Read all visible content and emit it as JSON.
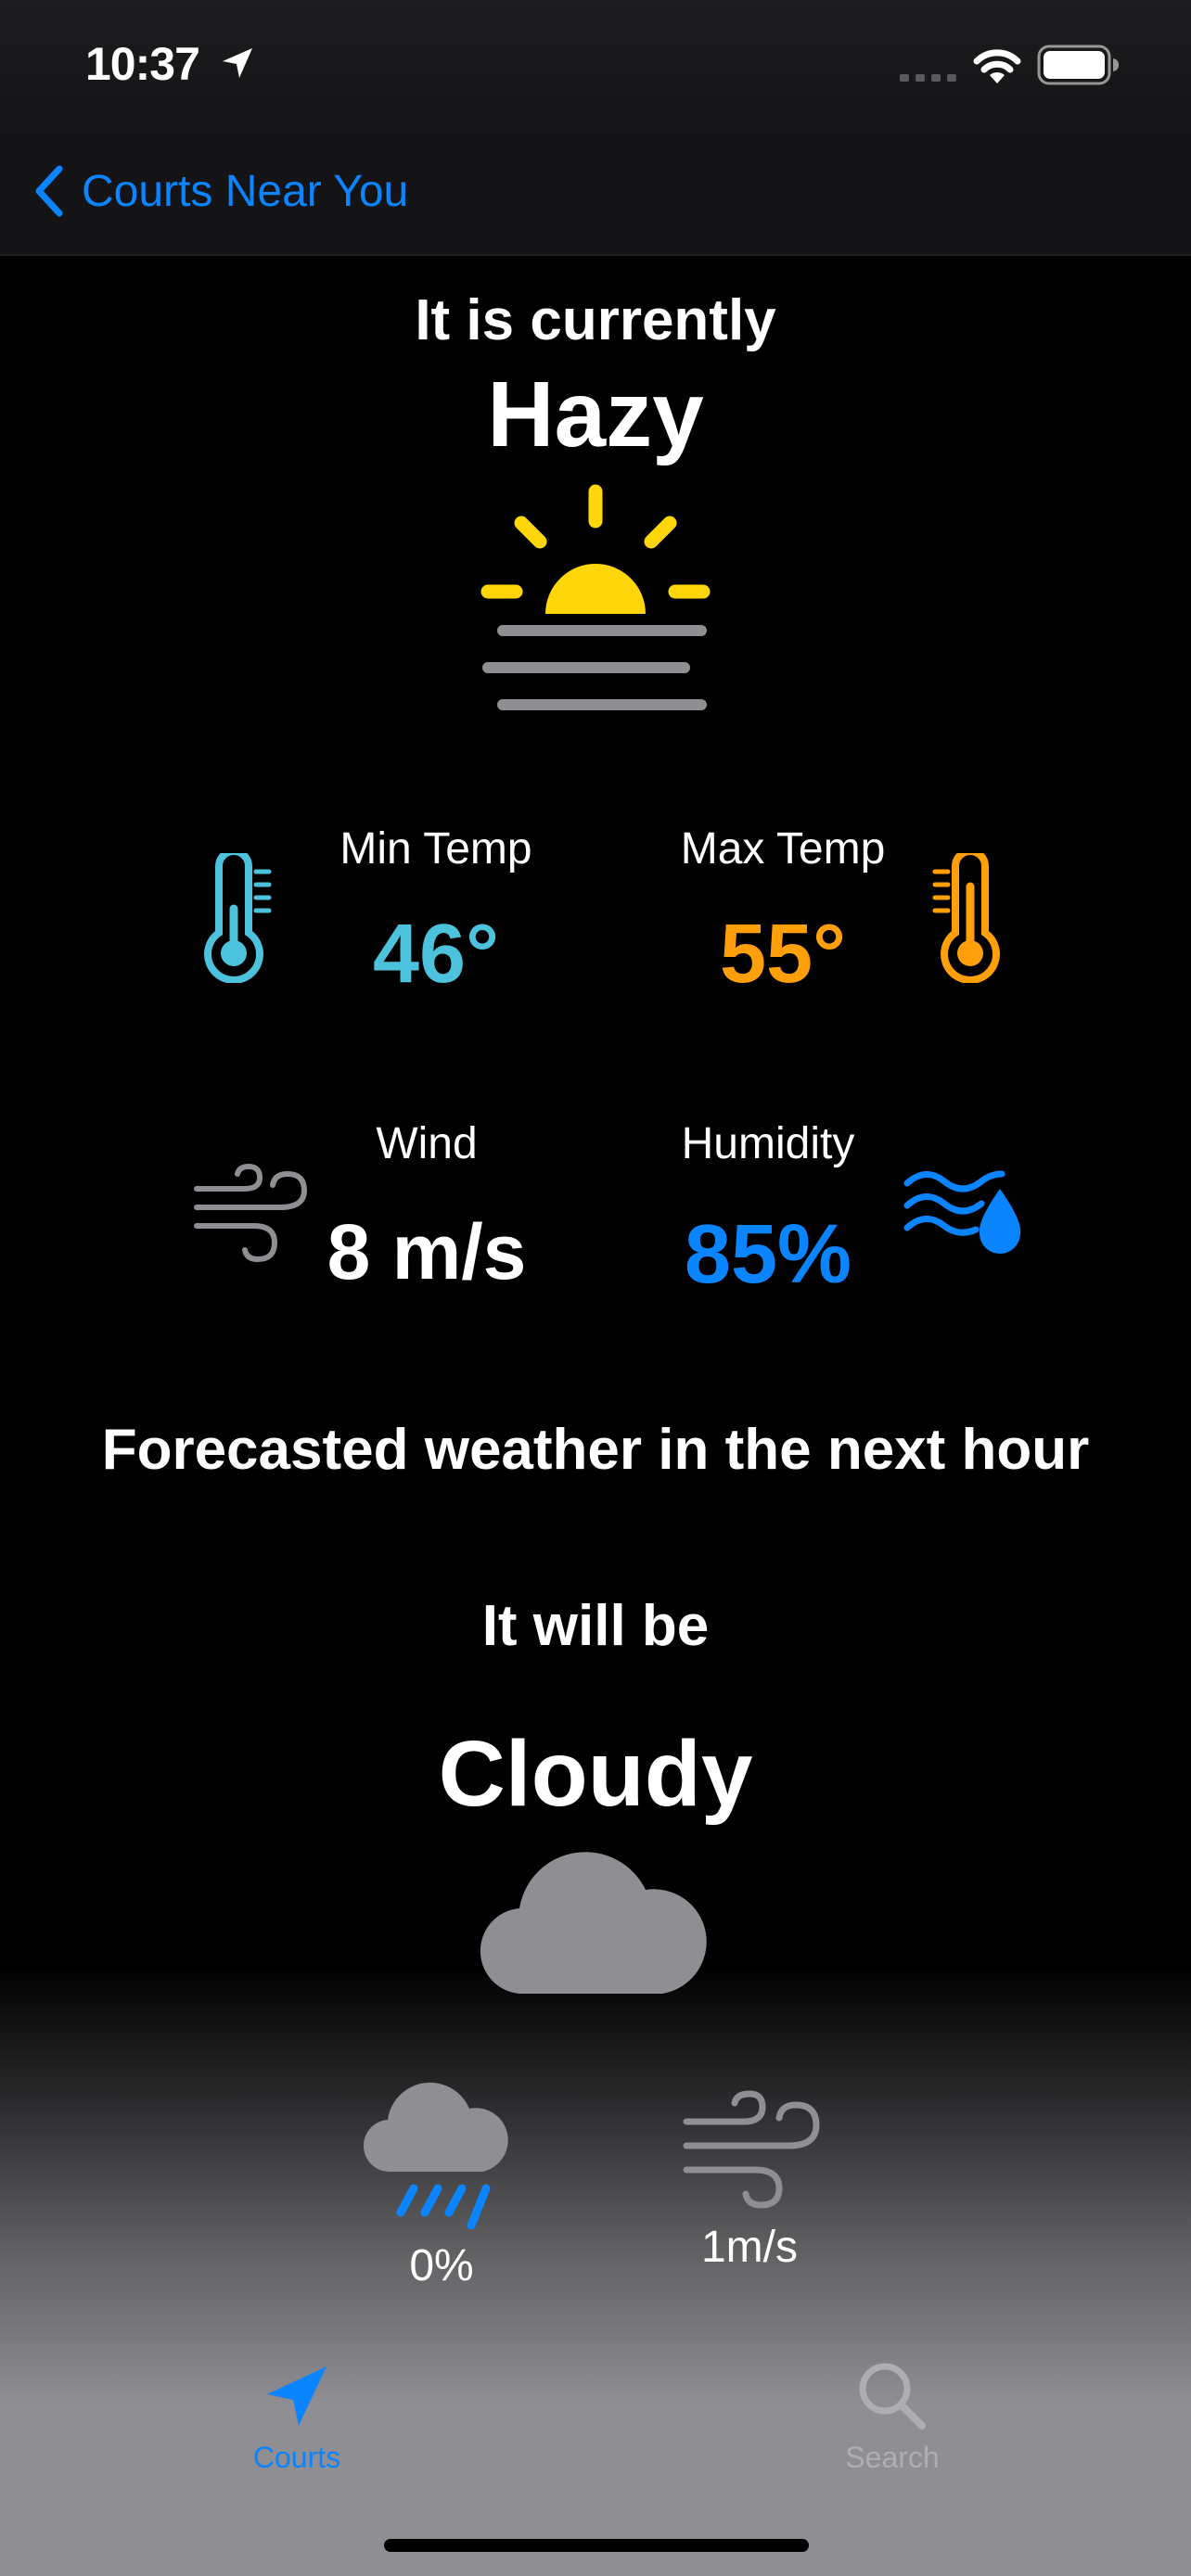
{
  "status": {
    "time": "10:37"
  },
  "nav": {
    "back_label": "Courts Near You"
  },
  "current": {
    "intro": "It is currently",
    "condition": "Hazy",
    "min_temp_label": "Min Temp",
    "min_temp_value": "46°",
    "max_temp_label": "Max Temp",
    "max_temp_value": "55°",
    "wind_label": "Wind",
    "wind_value": "8 m/s",
    "humidity_label": "Humidity",
    "humidity_value": "85%"
  },
  "forecast": {
    "title": "Forecasted weather in the next hour",
    "intro": "It will be",
    "condition": "Cloudy",
    "precip_value": "0%",
    "wind_value": "1m/s"
  },
  "tabs": [
    {
      "label": "Courts",
      "icon": "location-arrow-icon",
      "active": true
    },
    {
      "label": "Search",
      "icon": "magnifying-glass-icon",
      "active": false
    }
  ],
  "colors": {
    "accent": "#0a84ff",
    "cold": "#4cc2dc",
    "warm": "#ff9f0a",
    "sun": "#ffd60a",
    "gray": "#8e8e93"
  }
}
